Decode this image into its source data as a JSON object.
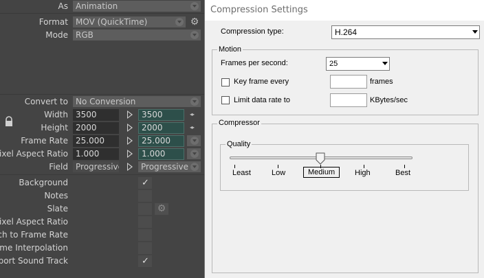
{
  "left": {
    "as_label": "As",
    "as_value": "Animation",
    "format_label": "Format",
    "format_value": "MOV (QuickTime)",
    "mode_label": "Mode",
    "mode_value": "RGB",
    "convert_label": "Convert to",
    "convert_value": "No Conversion",
    "width_label": "Width",
    "width_value": "3500",
    "width_out": "3500",
    "height_label": "Height",
    "height_value": "2000",
    "height_out": "2000",
    "framerate_label": "Frame Rate",
    "framerate_value": "25.000",
    "framerate_out": "25.000",
    "par_label": "Pixel Aspect Ratio",
    "par_value": "1.000",
    "par_out": "1.000",
    "field_label": "Field",
    "field_value": "Progressive",
    "field_out": "Progressive",
    "options": [
      {
        "label": "Background",
        "checked": true
      },
      {
        "label": "Notes",
        "checked": false
      },
      {
        "label": "Slate",
        "checked": false
      },
      {
        "label": "Pixel Aspect Ratio",
        "checked": false
      },
      {
        "label": "Stretch to Frame Rate",
        "checked": false
      },
      {
        "label": "Time Interpolation",
        "checked": false
      },
      {
        "label": "Export Sound Track",
        "checked": true
      }
    ]
  },
  "dialog": {
    "title": "Compression Settings",
    "compression_type_label": "Compression type:",
    "compression_type_value": "H.264",
    "motion_group": "Motion",
    "fps_label": "Frames per second:",
    "fps_value": "25",
    "keyframe_label": "Key frame every",
    "keyframe_value": "",
    "keyframe_unit": "frames",
    "keyframe_checked": false,
    "limit_label": "Limit data rate to",
    "limit_value": "",
    "limit_unit": "KBytes/sec",
    "limit_checked": false,
    "compressor_group": "Compressor",
    "quality_group": "Quality",
    "quality_levels": [
      "Least",
      "Low",
      "Medium",
      "High",
      "Best"
    ],
    "quality_selected": "Medium",
    "quality_index": 2
  }
}
